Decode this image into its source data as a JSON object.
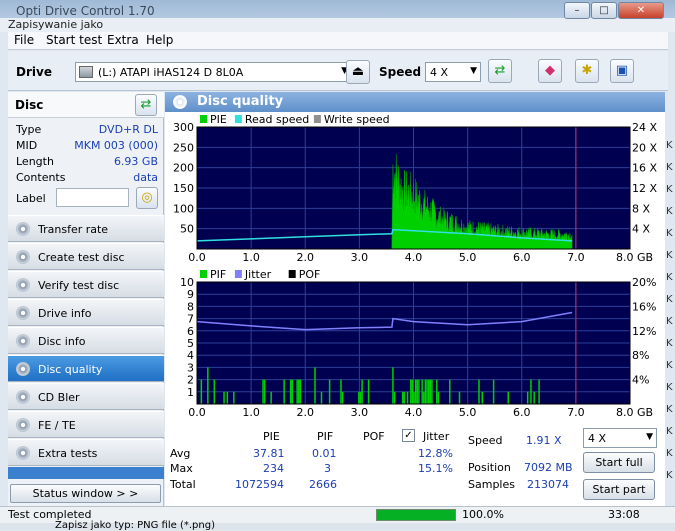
{
  "window": {
    "title": "Opti Drive Control 1.70",
    "subtitle": "Zapisywanie jako"
  },
  "menu": [
    "File",
    "Start test",
    "Extra",
    "Help"
  ],
  "toolbar": {
    "drive_label": "Drive",
    "drive_value": "(L:)   ATAPI iHAS124   D 8L0A",
    "speed_label": "Speed",
    "speed_value": "4 X"
  },
  "disc": {
    "header": "Disc",
    "rows": [
      {
        "k": "Type",
        "v": "DVD+R DL"
      },
      {
        "k": "MID",
        "v": "MKM 003 (000)"
      },
      {
        "k": "Length",
        "v": "6.93 GB"
      },
      {
        "k": "Contents",
        "v": "data"
      }
    ],
    "label_key": "Label",
    "label_value": ""
  },
  "nav": [
    "Transfer rate",
    "Create test disc",
    "Verify test disc",
    "Drive info",
    "Disc info",
    "Disc quality",
    "CD Bler",
    "FE / TE",
    "Extra tests"
  ],
  "nav_active": 5,
  "status_window": "Status window > >",
  "panel": {
    "title": "Disc quality"
  },
  "chart_data": [
    {
      "type": "area",
      "legend": [
        "PIE",
        "Read speed",
        "Write speed"
      ],
      "colors": {
        "PIE": "#00d000",
        "Read speed": "#30e0e0",
        "Write speed": "#909090"
      },
      "x_ticks": [
        "0.0",
        "1.0",
        "2.0",
        "3.0",
        "4.0",
        "5.0",
        "6.0",
        "7.0",
        "8.0 GB"
      ],
      "xlim": [
        0,
        8
      ],
      "y_ticks": [
        "300",
        "250",
        "200",
        "150",
        "100",
        "50"
      ],
      "ylim": [
        0,
        300
      ],
      "y2_ticks": [
        "24 X",
        "20 X",
        "16 X",
        "12 X",
        "8 X",
        "4 X"
      ],
      "y2lim": [
        0,
        24
      ],
      "pie_x": [
        0,
        1,
        2,
        3,
        3.6,
        3.62,
        3.8,
        4.0,
        4.2,
        4.5,
        5.0,
        5.5,
        6.0,
        6.5,
        6.93
      ],
      "pie_y": [
        0,
        0,
        0,
        0,
        0,
        220,
        160,
        150,
        120,
        85,
        60,
        50,
        45,
        40,
        40
      ],
      "read_x": [
        0,
        1,
        2,
        3,
        3.6,
        3.62,
        4,
        5,
        6,
        6.93
      ],
      "read_y": [
        1.6,
        2.0,
        2.4,
        2.8,
        3.0,
        3.8,
        3.6,
        3.0,
        2.2,
        1.6
      ]
    },
    {
      "type": "bar",
      "legend": [
        "PIF",
        "Jitter",
        "POF"
      ],
      "colors": {
        "PIF": "#00d000",
        "Jitter": "#8080ff",
        "POF": "#000000"
      },
      "x_ticks": [
        "0.0",
        "1.0",
        "2.0",
        "3.0",
        "4.0",
        "5.0",
        "6.0",
        "7.0",
        "8.0 GB"
      ],
      "xlim": [
        0,
        8
      ],
      "y_ticks": [
        "10",
        "9",
        "8",
        "7",
        "6",
        "5",
        "4",
        "3",
        "2",
        "1"
      ],
      "ylim": [
        0,
        10
      ],
      "y2_ticks": [
        "20%",
        "16%",
        "12%",
        "8%",
        "4%"
      ],
      "y2lim": [
        0,
        20
      ],
      "jitter_x": [
        0,
        1,
        2,
        3,
        3.6,
        3.62,
        4,
        5,
        6,
        6.93
      ],
      "jitter_y": [
        13.5,
        12.8,
        12.2,
        12.5,
        12.6,
        14.0,
        13.5,
        13.0,
        13.5,
        15.0
      ]
    }
  ],
  "stats": {
    "headers": [
      "PIE",
      "PIF",
      "POF",
      "Jitter"
    ],
    "jitter_checked": true,
    "rows": [
      {
        "k": "Avg",
        "pie": "37.81",
        "pif": "0.01",
        "jit": "12.8%"
      },
      {
        "k": "Max",
        "pie": "234",
        "pif": "3",
        "jit": "15.1%"
      },
      {
        "k": "Total",
        "pie": "1072594",
        "pif": "2666",
        "jit": ""
      }
    ],
    "speed_label": "Speed",
    "speed_value": "1.91 X",
    "position_label": "Position",
    "position_value": "7092 MB",
    "samples_label": "Samples",
    "samples_value": "213074",
    "speed_select": "4 X",
    "start_full": "Start full",
    "start_part": "Start part"
  },
  "statusbar": {
    "text": "Test completed",
    "percent": "100.0%",
    "time": "33:08"
  },
  "bottom": {
    "text": "Zapisz jako typ:  PNG file (*.png)"
  }
}
